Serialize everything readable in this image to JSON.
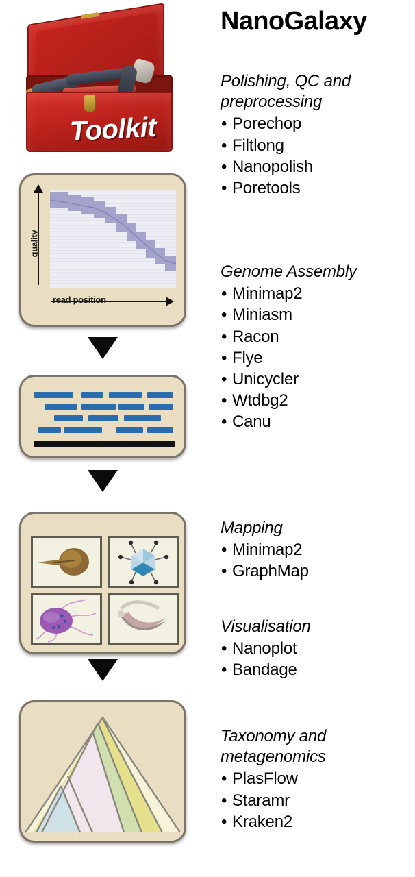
{
  "title": "NanoGalaxy",
  "sections": [
    {
      "heading": "Polishing, QC and preprocessing",
      "tools": [
        "Porechop",
        "Filtlong",
        "Nanopolish",
        "Poretools"
      ]
    },
    {
      "heading": "Genome Assembly",
      "tools": [
        "Minimap2",
        "Miniasm",
        "Racon",
        "Flye",
        "Unicycler",
        "Wtdbg2",
        "Canu"
      ]
    },
    {
      "heading": "Mapping",
      "tools": [
        "Minimap2",
        "GraphMap"
      ]
    },
    {
      "heading": "Visualisation",
      "tools": [
        "Nanoplot",
        "Bandage"
      ]
    },
    {
      "heading": "Taxonomy and metagenomics",
      "tools": [
        "PlasFlow",
        "Staramr",
        "Kraken2"
      ]
    }
  ],
  "pipeline": {
    "toolbox": {
      "label": "Toolkit",
      "box_color": "#bb221c",
      "latch_color": "#c8a23c"
    },
    "quality_plot": {
      "y_axis_label": "quality",
      "x_axis_label": "read position",
      "band_color": "#a3a3cc",
      "plot_background": "#eceef4"
    },
    "assembly": {
      "read_color": "#2a6cb0",
      "contig_color": "#111111"
    },
    "mapping_cells": [
      "sperm-organism-icon",
      "virus-organism-icon",
      "flagellate-organism-icon",
      "bacillus-organism-icon"
    ],
    "taxonomy": {
      "chart": "krona-nested-triangle",
      "band_colors": [
        "#cfe0e6",
        "#f0e6ec",
        "#cfdfae",
        "#e4e08c",
        "#f7f2d8"
      ]
    },
    "panel_background": "#e9ddc2",
    "panel_border": "#7c7468",
    "arrow_color": "#0b0b0b"
  }
}
